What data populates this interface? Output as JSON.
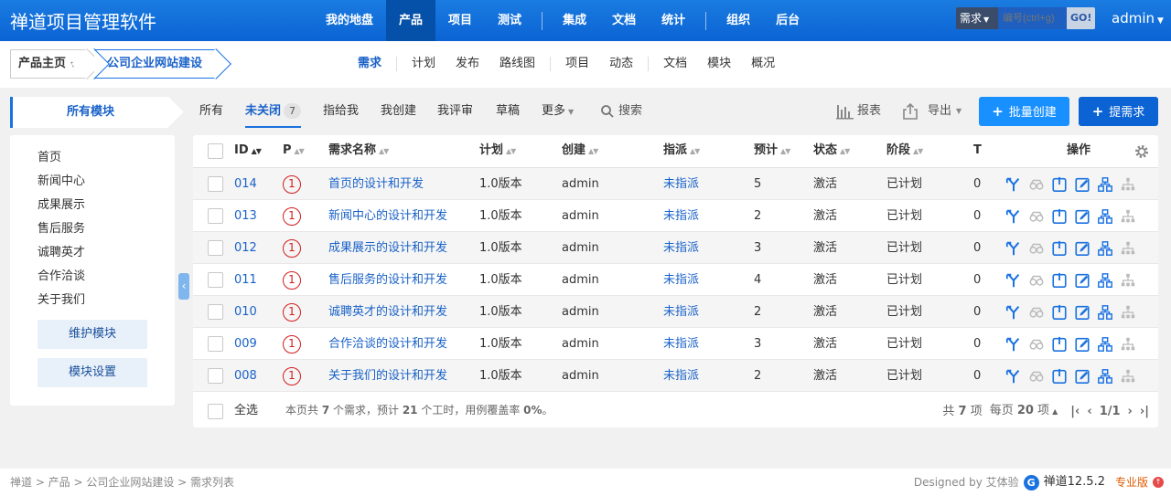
{
  "header": {
    "brand": "禅道项目管理软件",
    "nav": [
      {
        "label": "我的地盘",
        "active": false
      },
      {
        "label": "产品",
        "active": true
      },
      {
        "label": "项目",
        "active": false
      },
      {
        "label": "测试",
        "active": false
      },
      {
        "label": "集成",
        "active": false
      },
      {
        "label": "文档",
        "active": false
      },
      {
        "label": "统计",
        "active": false
      },
      {
        "label": "组织",
        "active": false
      },
      {
        "label": "后台",
        "active": false
      }
    ],
    "search_type": "需求",
    "search_placeholder": "编号(ctrl+g)",
    "search_go": "GO!",
    "user": "admin"
  },
  "subheader": {
    "crumb_home": "产品主页",
    "crumb_product": "公司企业网站建设",
    "tabs": [
      {
        "label": "需求",
        "active": true
      },
      {
        "label": "计划",
        "active": false
      },
      {
        "label": "发布",
        "active": false
      },
      {
        "label": "路线图",
        "active": false
      },
      {
        "label": "项目",
        "active": false
      },
      {
        "label": "动态",
        "active": false
      },
      {
        "label": "文档",
        "active": false
      },
      {
        "label": "模块",
        "active": false
      },
      {
        "label": "概况",
        "active": false
      }
    ]
  },
  "sidebar": {
    "title": "所有模块",
    "modules": [
      "首页",
      "新闻中心",
      "成果展示",
      "售后服务",
      "诚聘英才",
      "合作洽谈",
      "关于我们"
    ],
    "maintain_button": "维护模块",
    "settings_button": "模块设置"
  },
  "filters": {
    "all": "所有",
    "unclosed": "未关闭",
    "unclosed_count": "7",
    "assigned_to_me": "指给我",
    "created_by_me": "我创建",
    "reviewed_by_me": "我评审",
    "draft": "草稿",
    "more": "更多",
    "search": "搜索",
    "report": "报表",
    "export": "导出",
    "batch_create": "批量创建",
    "create": "提需求"
  },
  "table": {
    "columns": {
      "id": "ID",
      "pri": "P",
      "title": "需求名称",
      "plan": "计划",
      "creator": "创建",
      "assigned": "指派",
      "estimate": "预计",
      "status": "状态",
      "stage": "阶段",
      "tasks": "T",
      "actions": "操作"
    },
    "rows": [
      {
        "id": "014",
        "pri": "1",
        "title": "首页的设计和开发",
        "plan": "1.0版本",
        "creator": "admin",
        "assigned": "未指派",
        "estimate": "5",
        "status": "激活",
        "stage": "已计划",
        "tasks": "0"
      },
      {
        "id": "013",
        "pri": "1",
        "title": "新闻中心的设计和开发",
        "plan": "1.0版本",
        "creator": "admin",
        "assigned": "未指派",
        "estimate": "2",
        "status": "激活",
        "stage": "已计划",
        "tasks": "0"
      },
      {
        "id": "012",
        "pri": "1",
        "title": "成果展示的设计和开发",
        "plan": "1.0版本",
        "creator": "admin",
        "assigned": "未指派",
        "estimate": "3",
        "status": "激活",
        "stage": "已计划",
        "tasks": "0"
      },
      {
        "id": "011",
        "pri": "1",
        "title": "售后服务的设计和开发",
        "plan": "1.0版本",
        "creator": "admin",
        "assigned": "未指派",
        "estimate": "4",
        "status": "激活",
        "stage": "已计划",
        "tasks": "0"
      },
      {
        "id": "010",
        "pri": "1",
        "title": "诚聘英才的设计和开发",
        "plan": "1.0版本",
        "creator": "admin",
        "assigned": "未指派",
        "estimate": "2",
        "status": "激活",
        "stage": "已计划",
        "tasks": "0"
      },
      {
        "id": "009",
        "pri": "1",
        "title": "合作洽谈的设计和开发",
        "plan": "1.0版本",
        "creator": "admin",
        "assigned": "未指派",
        "estimate": "3",
        "status": "激活",
        "stage": "已计划",
        "tasks": "0"
      },
      {
        "id": "008",
        "pri": "1",
        "title": "关于我们的设计和开发",
        "plan": "1.0版本",
        "creator": "admin",
        "assigned": "未指派",
        "estimate": "2",
        "status": "激活",
        "stage": "已计划",
        "tasks": "0"
      }
    ],
    "footer": {
      "select_all": "全选",
      "summary_pre": "本页共 ",
      "summary_count": "7",
      "summary_mid": " 个需求，预计 ",
      "summary_hours": "21",
      "summary_mid2": " 个工时，用例覆盖率 ",
      "summary_cov": "0%",
      "summary_end": "。",
      "total_pre": "共 ",
      "total_count": "7",
      "total_post": " 项",
      "per_page_pre": "每页 ",
      "per_page": "20",
      "per_page_post": " 项",
      "page": "1/1"
    }
  },
  "statusbar": {
    "breadcrumb": "禅道 > 产品 > 公司企业网站建设 > 需求列表",
    "designed_by": "Designed by 艾体验",
    "version": "禅道12.5.2",
    "edition": "专业版"
  },
  "colors": {
    "primary": "#1a72e0",
    "header": "#0b63d4",
    "priority": "#d01e1e",
    "button": "#1890ff"
  }
}
